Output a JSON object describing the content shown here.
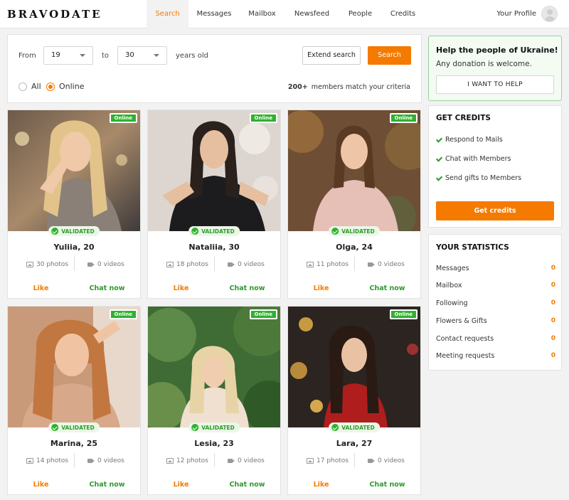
{
  "header": {
    "logo": "BRAVODATE",
    "nav": [
      {
        "label": "Search",
        "active": true
      },
      {
        "label": "Messages",
        "active": false
      },
      {
        "label": "Mailbox",
        "active": false
      },
      {
        "label": "Newsfeed",
        "active": false
      },
      {
        "label": "People",
        "active": false
      },
      {
        "label": "Credits",
        "active": false
      }
    ],
    "profile_label": "Your Profile"
  },
  "search": {
    "from_label": "From",
    "from_value": "19",
    "to_label": "to",
    "to_value": "30",
    "suffix": "years old",
    "extend_label": "Extend search",
    "search_label": "Search",
    "radio_all": "All",
    "radio_online": "Online",
    "selected": "Online",
    "match_count": "200+",
    "match_text": "members match your criteria"
  },
  "cards": [
    {
      "online": "Online",
      "validated": "VALIDATED",
      "name": "Yuliia, 20",
      "photos": "30 photos",
      "videos": "0 videos",
      "like": "Like",
      "chat": "Chat now"
    },
    {
      "online": "Online",
      "validated": "VALIDATED",
      "name": "Nataliia, 30",
      "photos": "18 photos",
      "videos": "0 videos",
      "like": "Like",
      "chat": "Chat now"
    },
    {
      "online": "Online",
      "validated": "VALIDATED",
      "name": "Olga, 24",
      "photos": "11 photos",
      "videos": "0 videos",
      "like": "Like",
      "chat": "Chat now"
    },
    {
      "online": "Online",
      "validated": "VALIDATED",
      "name": "Marina, 25",
      "photos": "14 photos",
      "videos": "0 videos",
      "like": "Like",
      "chat": "Chat now"
    },
    {
      "online": "Online",
      "validated": "VALIDATED",
      "name": "Lesia, 23",
      "photos": "12 photos",
      "videos": "0 videos",
      "like": "Like",
      "chat": "Chat now"
    },
    {
      "online": "Online",
      "validated": "VALIDATED",
      "name": "Lara, 27",
      "photos": "17 photos",
      "videos": "0 videos",
      "like": "Like",
      "chat": "Chat now"
    }
  ],
  "ukraine": {
    "title": "Help the people of Ukraine!",
    "text": "Any donation is welcome.",
    "button": "I WANT TO HELP"
  },
  "credits": {
    "title": "GET CREDITS",
    "items": [
      "Respond to Mails",
      "Chat with Members",
      "Send gifts to Members"
    ],
    "button": "Get credits"
  },
  "stats": {
    "title": "YOUR STATISTICS",
    "rows": [
      {
        "label": "Messages",
        "value": "0"
      },
      {
        "label": "Mailbox",
        "value": "0"
      },
      {
        "label": "Following",
        "value": "0"
      },
      {
        "label": "Flowers & Gifts",
        "value": "0"
      },
      {
        "label": "Contact requests",
        "value": "0"
      },
      {
        "label": "Meeting requests",
        "value": "0"
      }
    ]
  },
  "colors": {
    "accent": "#f47a00",
    "online": "#2fb12f",
    "validated_text": "#2e9a2e"
  }
}
